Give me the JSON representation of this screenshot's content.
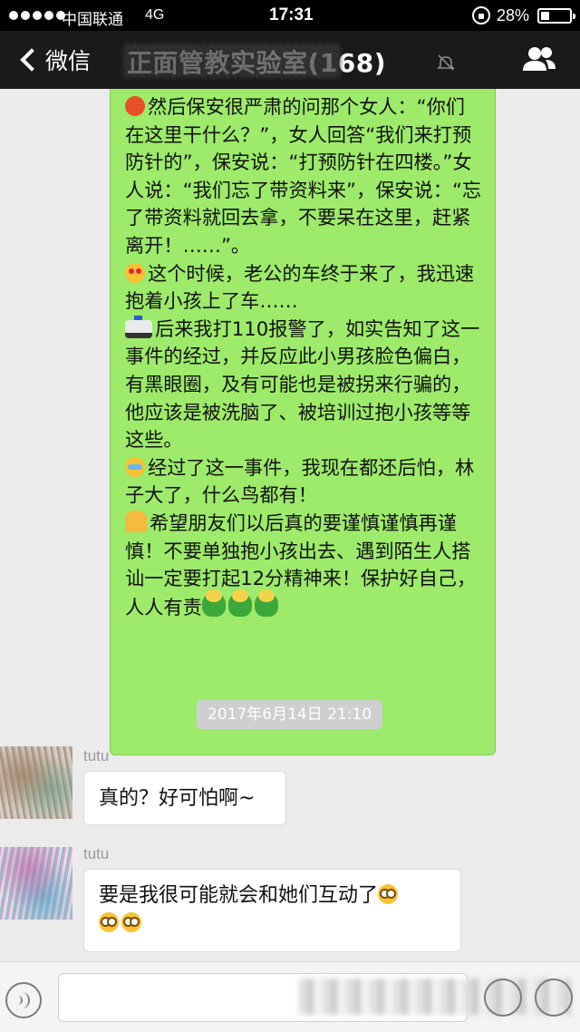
{
  "status_bar": {
    "carrier": "中国联通",
    "network": "4G",
    "time": "17:31",
    "battery": "28%"
  },
  "nav": {
    "back_label": "微信",
    "title": "正面管教实验室(168)"
  },
  "green_message": {
    "paragraphs": [
      {
        "icon": "angry-face-icon",
        "text": "然后保安很严肃的问那个女人：“你们在这里干什么？”，女人回答“我们来打预防针的”，保安说：“打预防针在四楼。”女人说：“我们忘了带资料来”，保安说：“忘了带资料就回去拿，不要呆在这里，赶紧离开！……”。"
      },
      {
        "icon": "heart-eyes-icon",
        "text": "这个时候，老公的车终于来了，我迅速抱着小孩上了车……"
      },
      {
        "icon": "police-car-icon",
        "text": "后来我打110报警了，如实告知了这一事件的经过，并反应此小男孩脸色偏白，有黑眼圈，及有可能也是被拐来行骗的，他应该是被洗脑了、被培训过抱小孩等等这些。"
      },
      {
        "icon": "crying-face-icon",
        "text": "经过了这一事件，我现在都还后怕，林子大了，什么鸟都有！"
      },
      {
        "icon": "praying-hands-icon",
        "text": "希望朋友们以后真的要谨慎谨慎再谨慎！不要单独抱小孩出去、遇到陌生人搭讪一定要打起12分精神来！保护好自己，人人有责"
      }
    ]
  },
  "timestamp": "2017年6月14日 21:10",
  "replies": [
    {
      "sender": "tutu",
      "text": "真的？好可怕啊~"
    },
    {
      "sender": "tutu",
      "text": "要是我很可能就会和她们互动了"
    }
  ],
  "colors": {
    "green_bubble": "#9eea6a",
    "nav_bg": "#1a1a1a",
    "chat_bg": "#ebebeb"
  }
}
